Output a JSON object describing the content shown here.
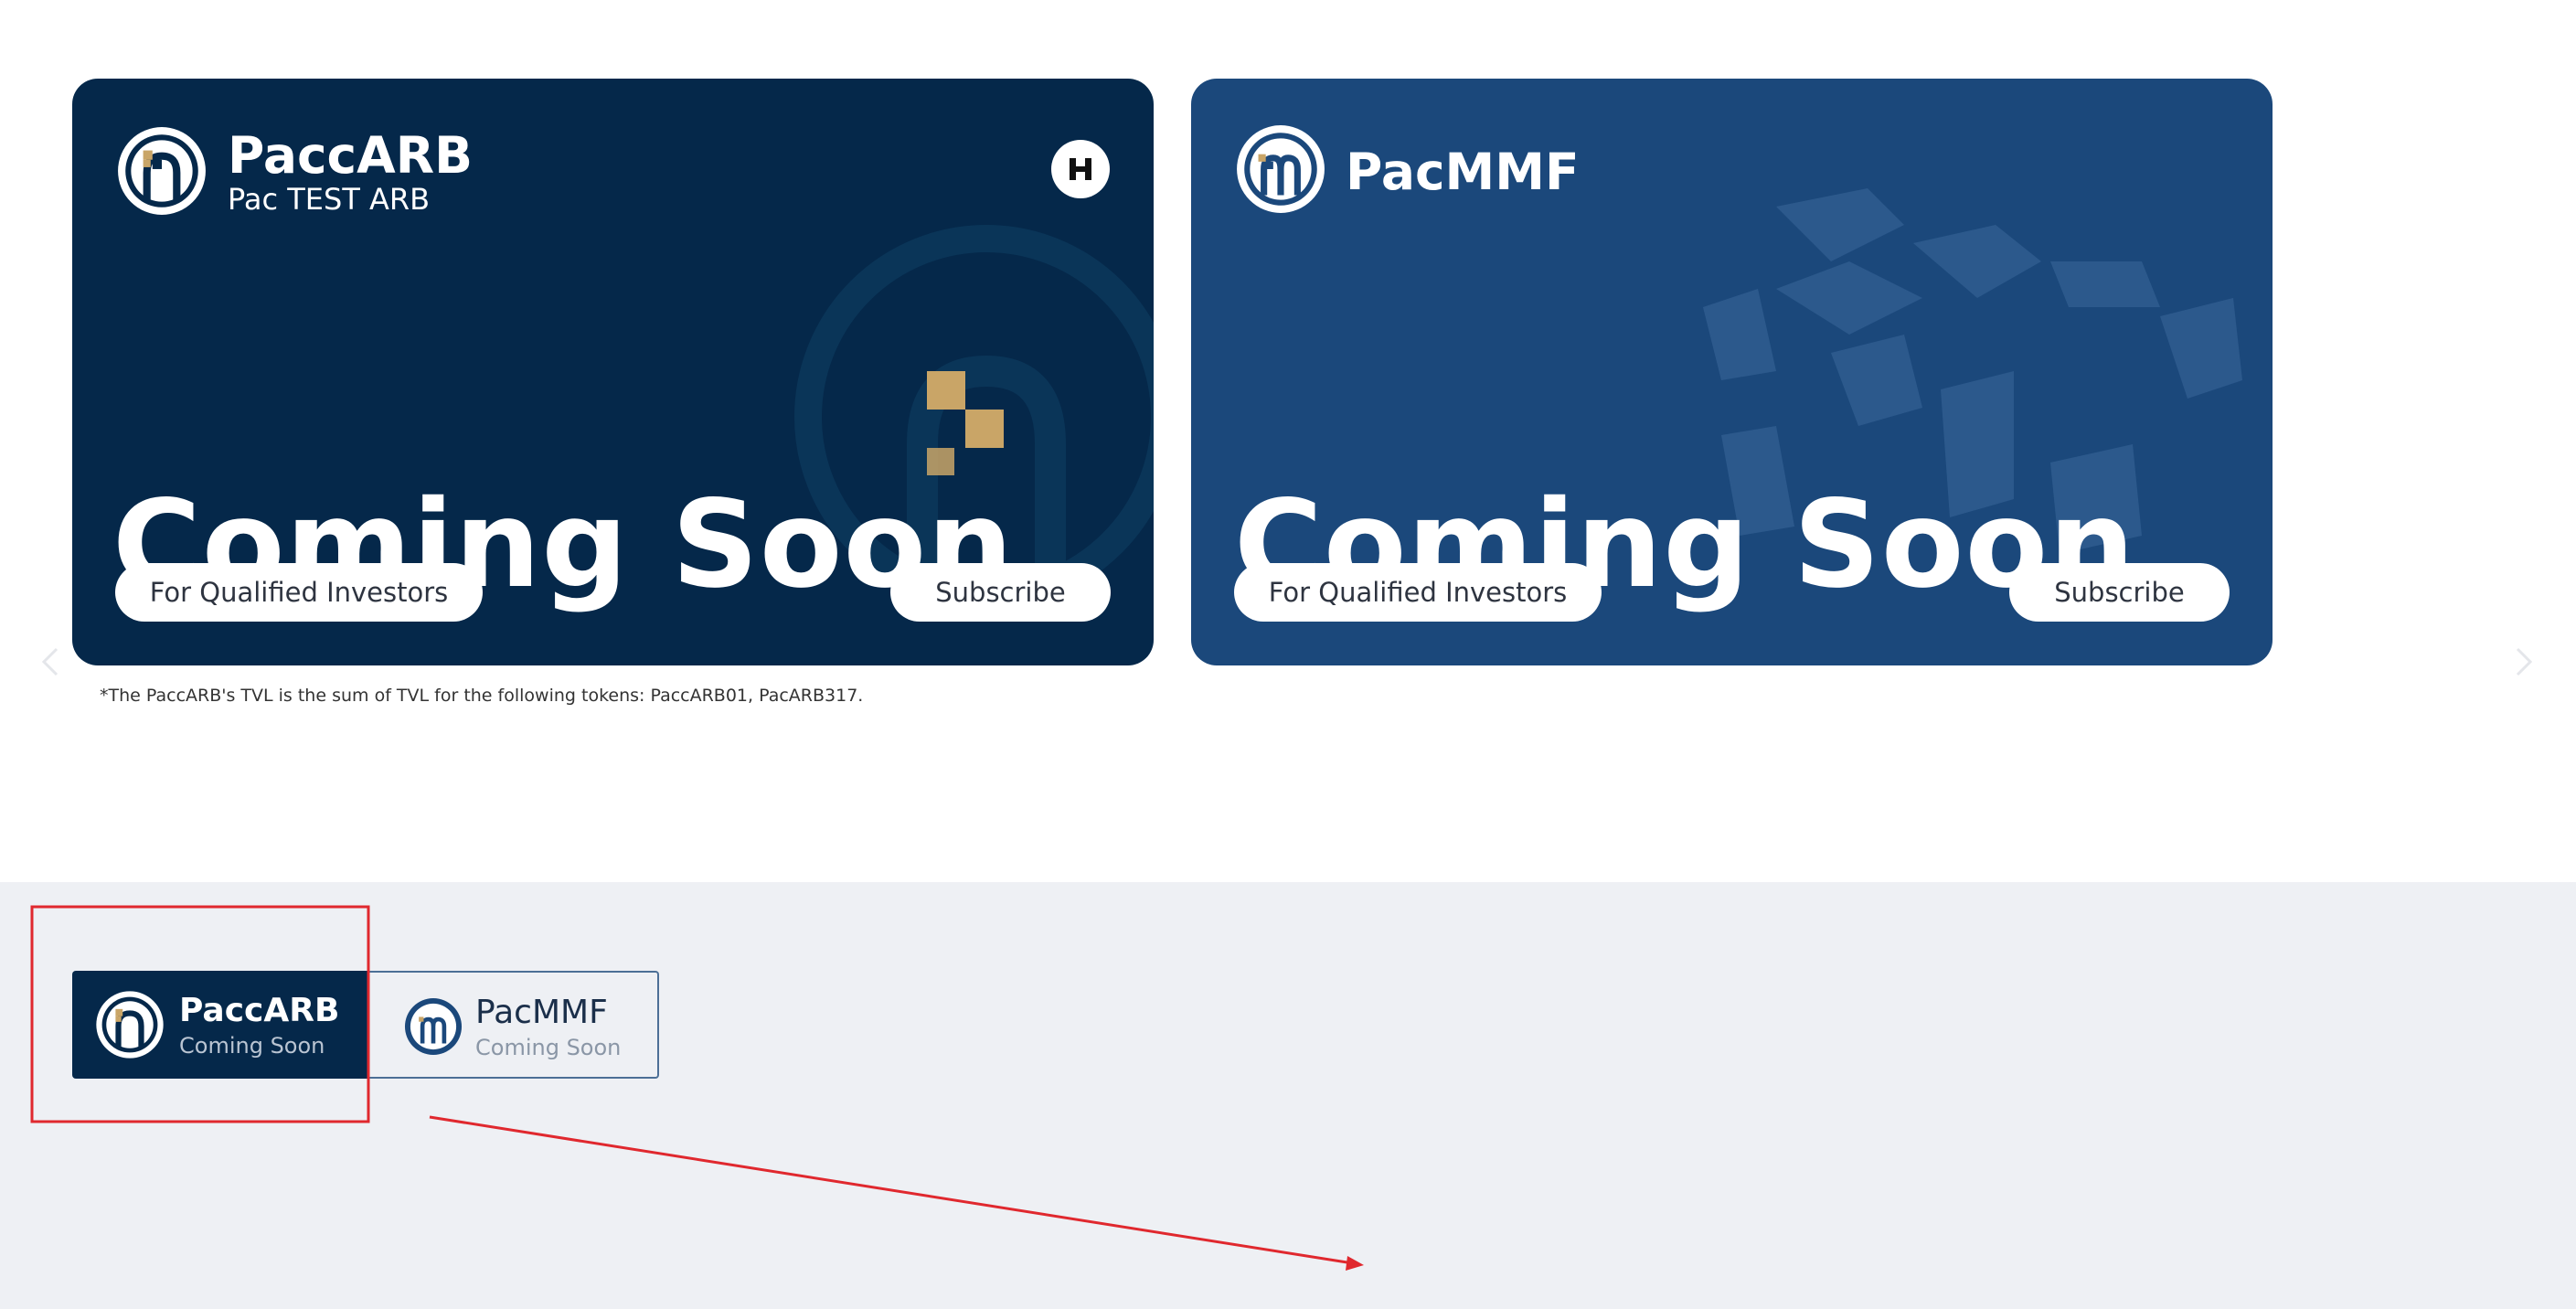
{
  "colors": {
    "card_navy": "#05284a",
    "card_blue": "#1b487b",
    "gold": "#c9a567",
    "section_gray": "#eef0f4",
    "annotation_red": "#e0282e"
  },
  "cards": [
    {
      "title": "PaccARB",
      "subtitle": "Pac TEST ARB",
      "headline": "Coming Soon",
      "badge": "For Qualified Investors",
      "cta": "Subscribe",
      "logo_icon": "paccarb-logo-icon",
      "partner_icon": "hashkey-h-icon"
    },
    {
      "title": "PacMMF",
      "headline": "Coming Soon",
      "badge": "For Qualified Investors",
      "cta": "Subscribe",
      "logo_icon": "pacmmf-logo-icon"
    }
  ],
  "footnote": "*The PaccARB's TVL is the sum of TVL for the following tokens: PaccARB01, PacARB317.",
  "tabs": [
    {
      "title": "PaccARB",
      "status": "Coming Soon",
      "selected": true
    },
    {
      "title": "PacMMF",
      "status": "Coming Soon",
      "selected": false
    }
  ],
  "nav": {
    "prev_icon": "chevron-left-icon",
    "next_icon": "chevron-right-icon"
  }
}
